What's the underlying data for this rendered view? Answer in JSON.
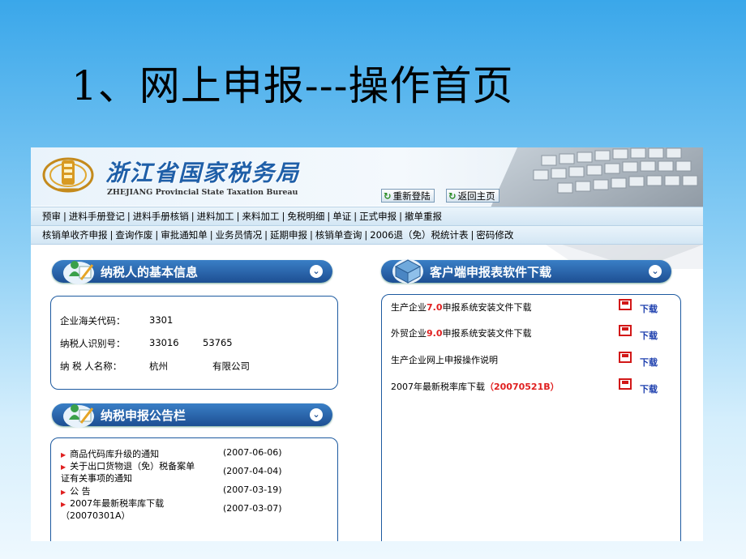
{
  "slide": {
    "title": "1、网上申报---操作首页"
  },
  "header": {
    "bureau_name_cn": "浙江省国家税务局",
    "bureau_name_en": "ZHEJIANG Provincial State Taxation Bureau",
    "relogin_label": "重新登陆",
    "home_label": "返回主页"
  },
  "nav": {
    "row1": [
      "预审",
      "进料手册登记",
      "进料手册核销",
      "进料加工",
      "来料加工",
      "免税明细",
      "单证",
      "正式申报",
      "撤单重报"
    ],
    "row2": [
      "核销单收齐申报",
      "查询作废",
      "审批通知单",
      "业务员情况",
      "延期申报",
      "核销单查询",
      "2006退（免）税统计表",
      "密码修改"
    ]
  },
  "taxpayer": {
    "section_title": "纳税人的基本信息",
    "customs_code_label": "企业海关代码：",
    "customs_code_value": "3301",
    "taxpayer_id_label": "纳税人识别号：",
    "taxpayer_id_value": "33016",
    "taxpayer_id_value2": "53765",
    "name_label": "纳 税 人名称：",
    "name_value": "杭州",
    "name_value2": "有限公司"
  },
  "bulletin": {
    "section_title": "纳税申报公告栏",
    "items": [
      {
        "title": "商品代码库升级的通知",
        "date": "(2007-06-06)"
      },
      {
        "title": "关于出口货物退（免）税备案单",
        "title2": "证有关事项的通知",
        "date": "(2007-04-04)"
      },
      {
        "title": "公 告",
        "date": "(2007-03-19)"
      },
      {
        "title": "2007年最新税率库下载",
        "title2": "（20070301A）",
        "date": "(2007-03-07)"
      }
    ]
  },
  "downloads": {
    "section_title": "客户端申报表软件下载",
    "link_label": "下载",
    "items": [
      {
        "pre": "生产企业",
        "ver": "7.0",
        "post": "申报系统安装文件下载"
      },
      {
        "pre": "外贸企业",
        "ver": "9.0",
        "post": "申报系统安装文件下载"
      },
      {
        "pre": "生产企业网上申报操作说明",
        "ver": "",
        "post": ""
      },
      {
        "pre": "2007年最新税率库下载",
        "ver": "（20070521B）",
        "post": ""
      }
    ]
  },
  "colors": {
    "accent": "#1d4f93",
    "alert": "#e02020",
    "link": "#1d3fae"
  }
}
